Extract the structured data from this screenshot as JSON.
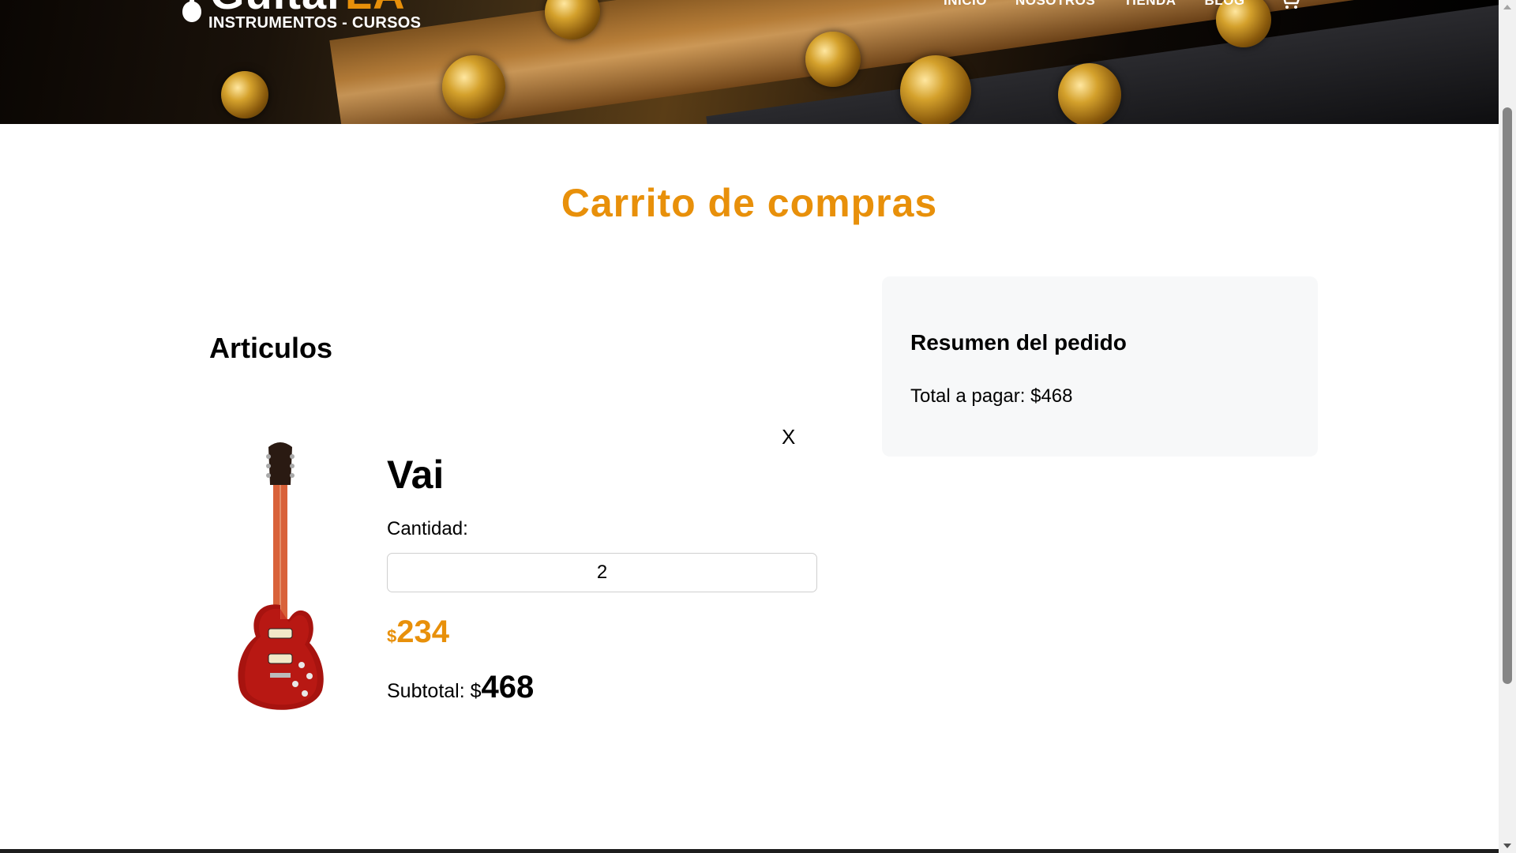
{
  "header": {
    "logo": {
      "brand_main": "Guitar",
      "brand_accent": "LA",
      "tagline": "INSTRUMENTOS - CURSOS"
    },
    "nav": [
      {
        "label": "INICIO"
      },
      {
        "label": "NOSOTROS"
      },
      {
        "label": "TIENDA"
      },
      {
        "label": "BLOG"
      }
    ],
    "cart_icon": "shopping-cart-icon"
  },
  "main": {
    "title": "Carrito de compras",
    "items_heading": "Articulos",
    "item": {
      "name": "Vai",
      "remove_label": "X",
      "quantity_label": "Cantidad:",
      "quantity_value": "2",
      "price_currency": "$",
      "price_value": "234",
      "subtotal_label": "Subtotal: $",
      "subtotal_value": "468",
      "image_icon": "electric-guitar-image"
    },
    "summary": {
      "title": "Resumen del pedido",
      "total_text": "Total a pagar: $468"
    }
  },
  "colors": {
    "accent": "#e8900a",
    "summary_bg": "#f7f8f9"
  }
}
